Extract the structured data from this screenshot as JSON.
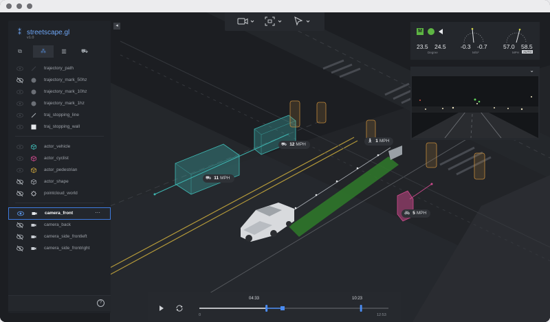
{
  "app": {
    "name": "streetscape.gl",
    "version": "v1.0"
  },
  "tabs": [
    {
      "label": "⧉",
      "name": "streams"
    },
    {
      "label": "⁂",
      "name": "objects"
    },
    {
      "label": "▥",
      "name": "map"
    },
    {
      "label": "⛟",
      "name": "vehicle"
    }
  ],
  "layers_group1": [
    {
      "label": "trajectory_path",
      "visible": "hidden-faint"
    },
    {
      "label": "trajectory_mark_50hz",
      "visible": "off"
    },
    {
      "label": "trajectory_mark_10hz",
      "visible": "hidden-faint"
    },
    {
      "label": "trajectory_mark_1hz",
      "visible": "hidden-faint"
    },
    {
      "label": "traj_stopping_line",
      "visible": "hidden-faint"
    },
    {
      "label": "traj_stopping_wall",
      "visible": "hidden-faint"
    }
  ],
  "layers_group2": [
    {
      "label": "actor_vehicle",
      "visible": "hidden-faint",
      "color": "#3fb8b3"
    },
    {
      "label": "actor_cyclist",
      "visible": "hidden-faint",
      "color": "#d04a8e"
    },
    {
      "label": "actor_pedestrian",
      "visible": "hidden-faint",
      "color": "#c8a23c"
    },
    {
      "label": "actor_shape",
      "visible": "off",
      "color": "#9ca1a8"
    },
    {
      "label": "pointcloud_world",
      "visible": "off",
      "color": "#9ca1a8"
    }
  ],
  "layers_group3": [
    {
      "label": "camera_front",
      "visible": "on"
    },
    {
      "label": "camera_back",
      "visible": "off"
    },
    {
      "label": "camera_side_frontleft",
      "visible": "off"
    },
    {
      "label": "camera_side_frontright",
      "visible": "off"
    }
  ],
  "selected_more": "···",
  "collapse_icon": "◂",
  "help_icon": "?",
  "meters": {
    "mode_badge": "M",
    "heading_a": "23.5",
    "heading_b": "24.5",
    "heading_caption": "Degree",
    "accel_a": "-0.3",
    "accel_b": "-0.7",
    "accel_caption": "M/S²",
    "speed_a": "57.0",
    "speed_b": "58.5",
    "speed_caption": "MPH",
    "speed_badge": "AUTO"
  },
  "camera_menu_icon": "⌄",
  "map_labels": [
    {
      "value": "12",
      "unit": "MPH",
      "kind": "vehicle"
    },
    {
      "value": "11",
      "unit": "MPH",
      "kind": "vehicle"
    },
    {
      "value": "1",
      "unit": "MPH",
      "kind": "pedestrian"
    },
    {
      "value": "5",
      "unit": "MPH",
      "kind": "cyclist"
    }
  ],
  "timeline": {
    "current_time": "04:33",
    "lookahead_time": "10:23",
    "start": "0",
    "end": "12:53",
    "playhead_fraction": 0.355,
    "buffer_fraction": 0.44,
    "lookahead_fraction": 0.855
  },
  "colors": {
    "accent": "#4a8bf0",
    "vehicle": "#3fb8b3",
    "cyclist": "#d04a8e",
    "pedestrian": "#c8a23c",
    "trajectory": "#3e8a2f"
  }
}
